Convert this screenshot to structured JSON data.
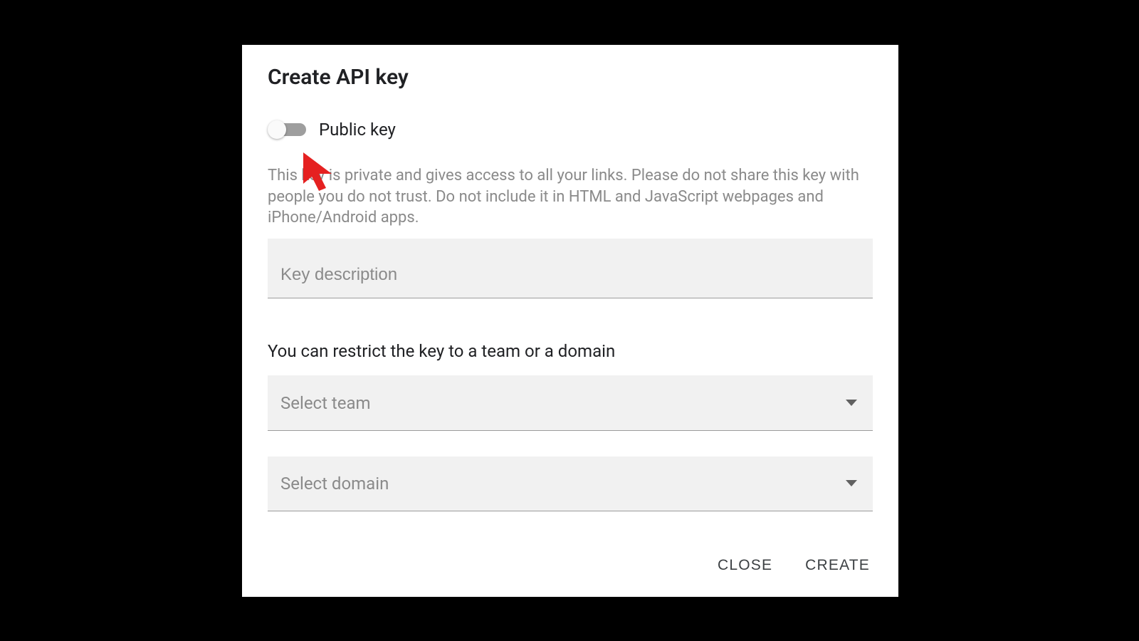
{
  "dialog": {
    "title": "Create API key",
    "toggle_label": "Public key",
    "toggle_on": false,
    "description": "This key is private and gives access to all your links. Please do not share this key with people you do not trust. Do not include it in HTML and JavaScript webpages and iPhone/Android apps.",
    "key_description_placeholder": "Key description",
    "key_description_value": "",
    "restrict_label": "You can restrict the key to a team or a domain",
    "team_select_placeholder": "Select team",
    "team_select_value": "",
    "domain_select_placeholder": "Select domain",
    "domain_select_value": "",
    "close_label": "CLOSE",
    "create_label": "CREATE"
  },
  "annotation": {
    "cursor_color": "#e52121"
  }
}
